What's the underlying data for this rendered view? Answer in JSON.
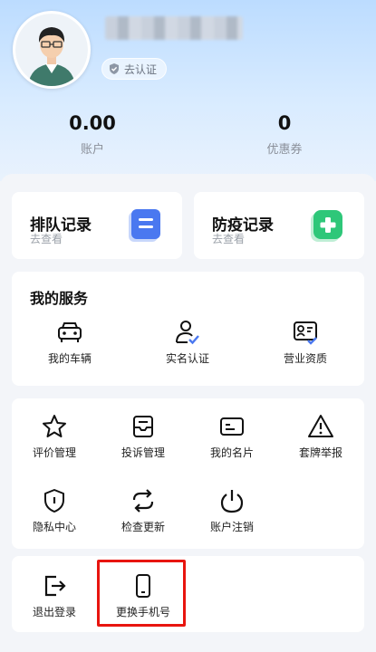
{
  "profile": {
    "certify_label": "去认证",
    "balance_value": "0.00",
    "balance_label": "账户",
    "coupon_value": "0",
    "coupon_label": "优惠券"
  },
  "records": [
    {
      "title": "排队记录",
      "subtitle": "去查看",
      "icon": "document-icon",
      "color": "#4a78f0"
    },
    {
      "title": "防疫记录",
      "subtitle": "去查看",
      "icon": "medical-cross-icon",
      "color": "#2ec779"
    }
  ],
  "services": {
    "title": "我的服务",
    "items": [
      {
        "label": "我的车辆",
        "icon": "car-icon"
      },
      {
        "label": "实名认证",
        "icon": "user-verified-icon"
      },
      {
        "label": "营业资质",
        "icon": "license-icon"
      }
    ]
  },
  "tools": {
    "items": [
      {
        "label": "评价管理",
        "icon": "star-icon"
      },
      {
        "label": "投诉管理",
        "icon": "inbox-icon"
      },
      {
        "label": "我的名片",
        "icon": "card-icon"
      },
      {
        "label": "套牌举报",
        "icon": "warning-icon"
      },
      {
        "label": "隐私中心",
        "icon": "shield-icon"
      },
      {
        "label": "检查更新",
        "icon": "refresh-icon"
      },
      {
        "label": "账户注销",
        "icon": "power-icon"
      }
    ]
  },
  "account": {
    "items": [
      {
        "label": "退出登录",
        "icon": "logout-icon"
      },
      {
        "label": "更换手机号",
        "icon": "phone-icon"
      }
    ]
  },
  "colors": {
    "accent": "#4a78f0",
    "highlight": "#e8150f",
    "header_bg": "#bcdcff"
  }
}
